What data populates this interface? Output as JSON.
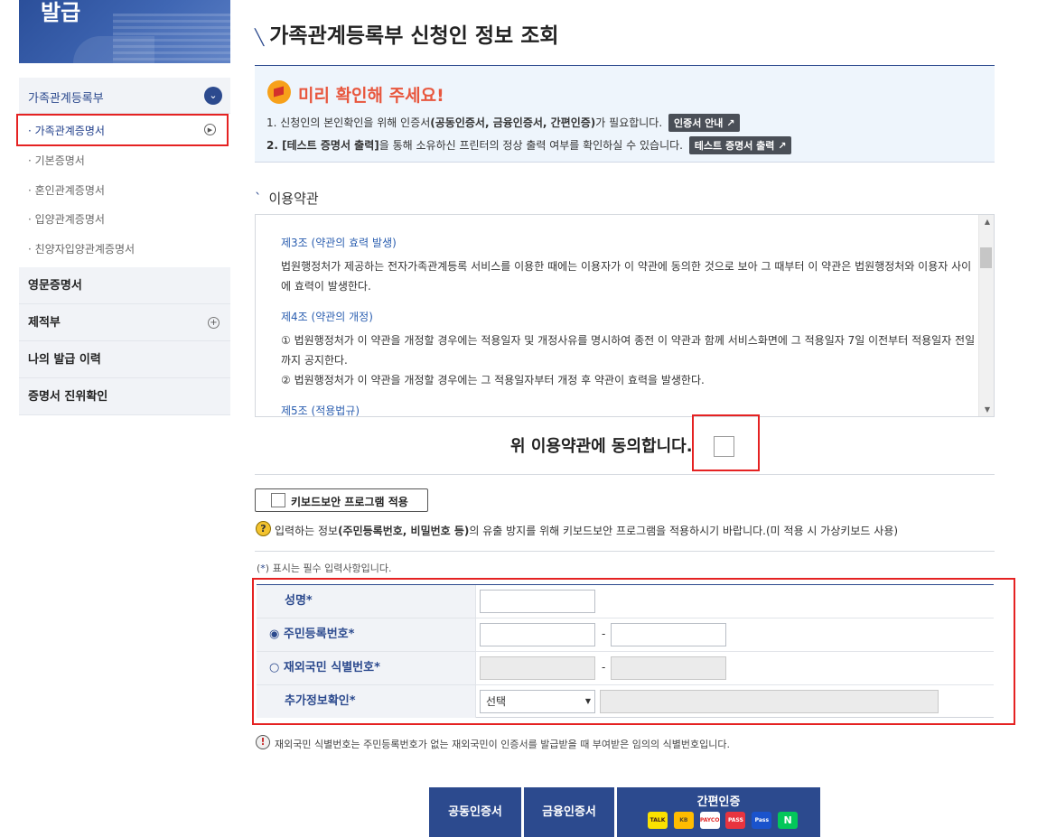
{
  "banner": {
    "text": "발급"
  },
  "sidebar": {
    "head": {
      "label": "가족관계등록부"
    },
    "sub_items": [
      "· 가족관계증명서",
      "· 기본증명서",
      "· 혼인관계증명서",
      "· 입양관계증명서",
      "· 친양자입양관계증명서"
    ],
    "groups": [
      "영문증명서",
      "제적부",
      "나의 발급 이력",
      "증명서 진위확인"
    ]
  },
  "page": {
    "title": "가족관계등록부 신청인 정보 조회"
  },
  "notice": {
    "title": "미리 확인해 주세요!",
    "line1_pre": "1. 신청인의 본인확인을 위해 인증서",
    "line1_bold": "(공동인증서, 금융인증서, 간편인증)",
    "line1_post": "가 필요합니다.",
    "line1_button": "인증서 안내 ↗",
    "line2_bold": "2. [테스트 증명서 출력]",
    "line2_post": "을 통해 소유하신 프린터의 정상 출력 여부를 확인하실 수 있습니다.",
    "line2_button": "테스트 증명서 출력 ↗"
  },
  "terms": {
    "heading": "이용약관",
    "articles": [
      {
        "title": "제3조 (약관의 효력 발생)",
        "text": "법원행정처가 제공하는 전자가족관계등록 서비스를 이용한 때에는 이용자가 이 약관에 동의한 것으로 보아 그 때부터 이 약관은 법원행정처와 이용자 사이에 효력이 발생한다."
      },
      {
        "title": "제4조 (약관의 개정)",
        "text": "① 법원행정처가 이 약관을 개정할 경우에는 적용일자 및 개정사유를 명시하여 종전 이 약관과 함께 서비스화면에 그 적용일자 7일 이전부터 적용일자 전일까지 공지한다.\n② 법원행정처가 이 약관을 개정할 경우에는 그 적용일자부터 개정 후 약관이 효력을 발생한다."
      },
      {
        "title": "제5조 (적용법규)",
        "text": ""
      }
    ]
  },
  "agree": {
    "label": "위 이용약관에 동의합니다."
  },
  "keyboard": {
    "button_label": "키보드보안 프로그램 적용",
    "help_pre": "입력하는 정보",
    "help_bold": "(주민등록번호, 비밀번호 등)",
    "help_post": "의 유출 방지를 위해 키보드보안 프로그램을 적용하시기 바랍니다.(미 적용 시 가상키보드 사용)"
  },
  "form": {
    "required_pre": "(",
    "required_star": "*",
    "required_post": ") 표시는 필수 입력사항입니다.",
    "name_label": "성명",
    "rrn_label": "◉ 주민등록번호",
    "overseas_label": "○ 재외국민 식별번호",
    "extra_label": "추가정보확인",
    "star": "*",
    "dash": "-",
    "select_value": "선택"
  },
  "warning": {
    "text": "재외국민 식별번호는 주민등록번호가 없는 재외국민이 인증서를 발급받을 때 부여받은 임의의 식별번호입니다."
  },
  "auth": {
    "joint_label": "공동인증서",
    "financial_label": "금융인증서",
    "simple_label": "간편인증",
    "logos": [
      "TALK",
      "KB",
      "PAYCO",
      "PASS",
      "Pass",
      "N"
    ]
  },
  "colors": {
    "accent": "#2c4a8e",
    "highlight": "#e52222",
    "notice_title": "#e8573e"
  }
}
